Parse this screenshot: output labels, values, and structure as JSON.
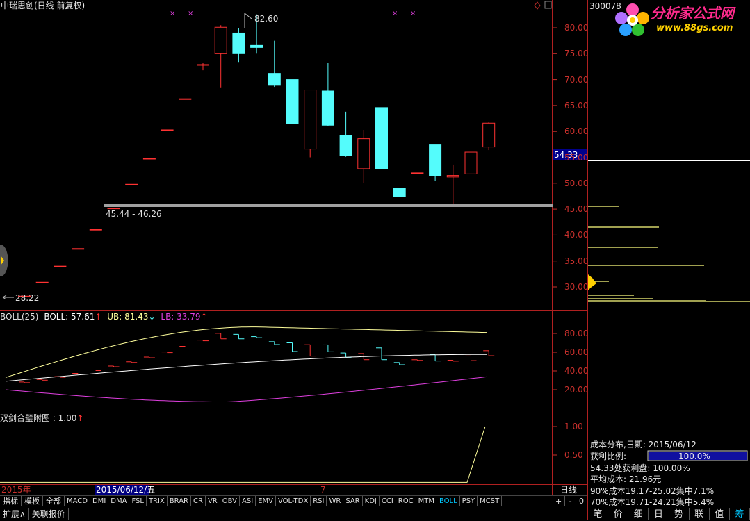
{
  "header": {
    "stock_title": "中瑞思创(日线 前复权)",
    "stock_code": "300078"
  },
  "logo": {
    "name": "分析家公式网",
    "url_text": "www.88gs.com"
  },
  "main_chart": {
    "y_ticks": [
      "80.00",
      "75.00",
      "70.00",
      "65.00",
      "60.00",
      "55.00",
      "50.00",
      "45.00",
      "40.00",
      "35.00",
      "30.00"
    ],
    "y_tick_values": [
      80,
      75,
      70,
      65,
      60,
      55,
      50,
      45,
      40,
      35,
      30
    ],
    "high_label": "82.60",
    "low_label": "28.22",
    "range_label": "45.44 - 46.26",
    "current_price": "54.33",
    "candles": [
      {
        "o": 28.22,
        "h": 28.22,
        "l": 28.22,
        "c": 28.22
      },
      {
        "o": 30.9,
        "h": 30.9,
        "l": 30.9,
        "c": 30.9
      },
      {
        "o": 34.0,
        "h": 34.0,
        "l": 34.0,
        "c": 34.0
      },
      {
        "o": 37.4,
        "h": 37.4,
        "l": 37.4,
        "c": 37.4
      },
      {
        "o": 41.1,
        "h": 41.1,
        "l": 41.1,
        "c": 41.1
      },
      {
        "o": 45.2,
        "h": 45.2,
        "l": 45.2,
        "c": 45.2
      },
      {
        "o": 49.8,
        "h": 49.8,
        "l": 49.8,
        "c": 49.8
      },
      {
        "o": 54.8,
        "h": 54.8,
        "l": 54.8,
        "c": 54.8
      },
      {
        "o": 60.3,
        "h": 60.3,
        "l": 60.3,
        "c": 60.3
      },
      {
        "o": 66.3,
        "h": 66.3,
        "l": 66.3,
        "c": 66.3
      },
      {
        "o": 72.9,
        "h": 73.2,
        "l": 71.8,
        "c": 72.9
      },
      {
        "o": 75.0,
        "h": 80.5,
        "l": 68.5,
        "c": 80.1
      },
      {
        "o": 79.0,
        "h": 80.0,
        "l": 73.4,
        "c": 75.0
      },
      {
        "o": 76.6,
        "h": 82.6,
        "l": 75.0,
        "c": 76.2
      },
      {
        "o": 71.2,
        "h": 77.5,
        "l": 68.6,
        "c": 68.9
      },
      {
        "o": 70.0,
        "h": 70.0,
        "l": 61.5,
        "c": 61.5
      },
      {
        "o": 56.6,
        "h": 68.0,
        "l": 55.0,
        "c": 68.0
      },
      {
        "o": 67.8,
        "h": 73.2,
        "l": 61.0,
        "c": 61.2
      },
      {
        "o": 59.2,
        "h": 63.8,
        "l": 55.1,
        "c": 55.3
      },
      {
        "o": 52.8,
        "h": 60.3,
        "l": 50.1,
        "c": 58.6
      },
      {
        "o": 64.6,
        "h": 64.6,
        "l": 52.8,
        "c": 52.8
      },
      {
        "o": 49.0,
        "h": 49.0,
        "l": 47.4,
        "c": 47.4
      },
      {
        "o": 52.0,
        "h": 52.0,
        "l": 52.0,
        "c": 52.0
      },
      {
        "o": 57.4,
        "h": 57.4,
        "l": 50.5,
        "c": 51.4
      },
      {
        "o": 51.2,
        "h": 53.6,
        "l": 45.6,
        "c": 51.5
      },
      {
        "o": 51.8,
        "h": 56.3,
        "l": 50.8,
        "c": 56.0
      },
      {
        "o": 57.0,
        "h": 61.9,
        "l": 56.4,
        "c": 61.6
      }
    ]
  },
  "boll_panel": {
    "title": "BOLL(25)",
    "boll_label": "BOLL: 57.61",
    "ub_label": "UB: 81.43",
    "lb_label": "LB: 33.79",
    "y_ticks": [
      "80.00",
      "60.00",
      "40.00",
      "20.00"
    ],
    "y_tick_values": [
      80,
      60,
      40,
      20
    ]
  },
  "sub_panel": {
    "title": "双剑合璧附图 : 1.00",
    "y_ticks": [
      "1.00",
      "0.50"
    ],
    "y_tick_values": [
      1.0,
      0.5
    ]
  },
  "timeline": {
    "year_label": "2015年",
    "date_label": "2015/06/12/五",
    "month_marker": "7",
    "period_label": "日线"
  },
  "indicator_tabs": [
    "指标",
    "模板",
    "全部",
    "MACD",
    "DMI",
    "DMA",
    "FSL",
    "TRIX",
    "BRAR",
    "CR",
    "VR",
    "OBV",
    "ASI",
    "EMV",
    "VOL-TDX",
    "RSI",
    "WR",
    "SAR",
    "KDJ",
    "CCI",
    "ROC",
    "MTM",
    "BOLL",
    "PSY",
    "MCST"
  ],
  "active_tab": "BOLL",
  "zoom_buttons": [
    "+",
    "-",
    "0"
  ],
  "bottom_row": [
    "扩展∧",
    "关联报价"
  ],
  "cost_panel": {
    "title": "成本分布,日期: 2015/06/12",
    "profit_ratio_label": "获利比例:",
    "profit_ratio_value": "100.0%",
    "profit_at_price": "54.33处获利盘: 100.00%",
    "avg_cost": "平均成本: 21.96元",
    "cost_90": "90%成本19.17-25.02集中7.1%",
    "cost_70": "70%成本19.71-24.21集中5.4%"
  },
  "right_tabs": [
    "笔",
    "价",
    "细",
    "日",
    "势",
    "联",
    "值",
    "筹"
  ],
  "active_right_tab": "筹",
  "colors": {
    "up": "#ff3232",
    "down": "#54fcfc",
    "axis": "#c8302c",
    "boll_mid": "#ffffff",
    "boll_up": "#ffff9c",
    "boll_lb": "#e040e0"
  }
}
